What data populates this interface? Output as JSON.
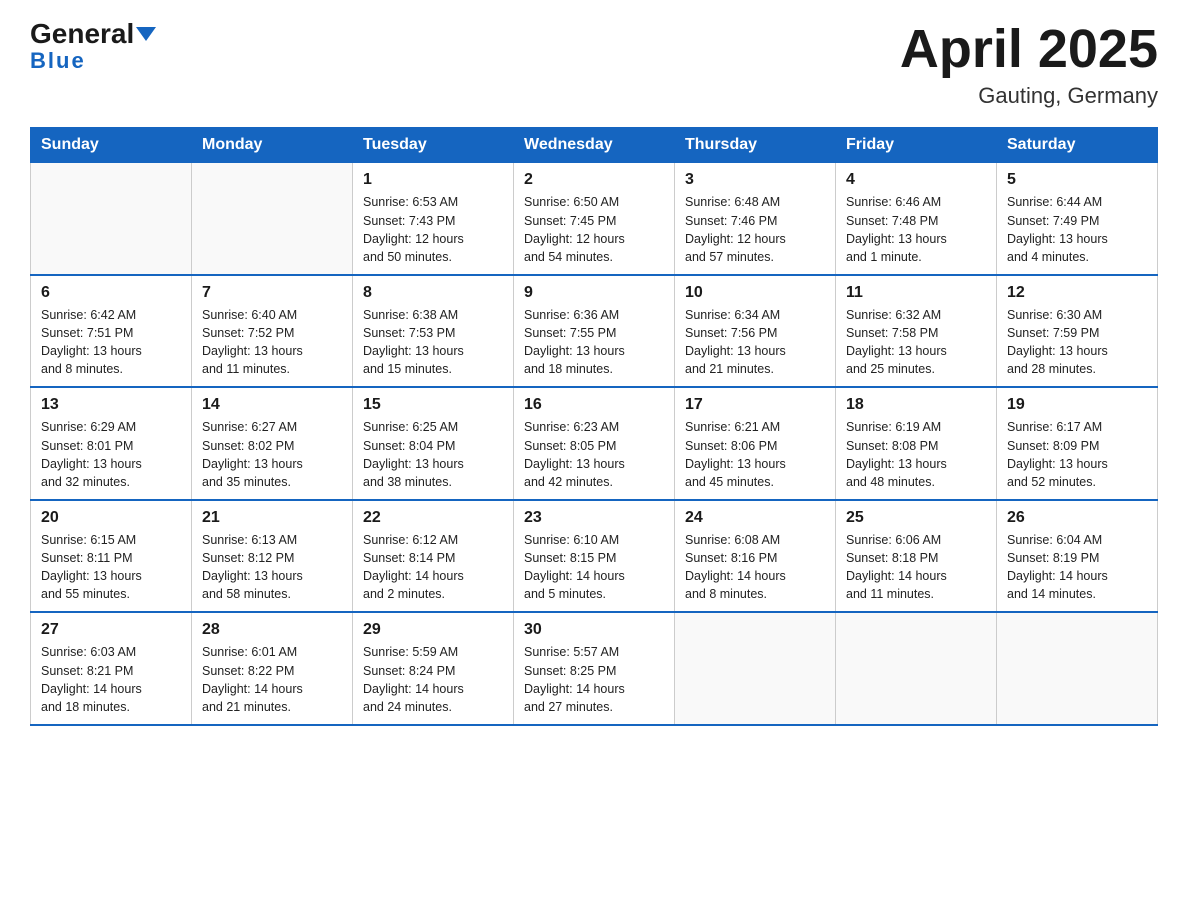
{
  "header": {
    "logo_general": "General",
    "logo_blue": "Blue",
    "title": "April 2025",
    "subtitle": "Gauting, Germany"
  },
  "weekdays": [
    "Sunday",
    "Monday",
    "Tuesday",
    "Wednesday",
    "Thursday",
    "Friday",
    "Saturday"
  ],
  "weeks": [
    [
      {
        "day": "",
        "info": ""
      },
      {
        "day": "",
        "info": ""
      },
      {
        "day": "1",
        "info": "Sunrise: 6:53 AM\nSunset: 7:43 PM\nDaylight: 12 hours\nand 50 minutes."
      },
      {
        "day": "2",
        "info": "Sunrise: 6:50 AM\nSunset: 7:45 PM\nDaylight: 12 hours\nand 54 minutes."
      },
      {
        "day": "3",
        "info": "Sunrise: 6:48 AM\nSunset: 7:46 PM\nDaylight: 12 hours\nand 57 minutes."
      },
      {
        "day": "4",
        "info": "Sunrise: 6:46 AM\nSunset: 7:48 PM\nDaylight: 13 hours\nand 1 minute."
      },
      {
        "day": "5",
        "info": "Sunrise: 6:44 AM\nSunset: 7:49 PM\nDaylight: 13 hours\nand 4 minutes."
      }
    ],
    [
      {
        "day": "6",
        "info": "Sunrise: 6:42 AM\nSunset: 7:51 PM\nDaylight: 13 hours\nand 8 minutes."
      },
      {
        "day": "7",
        "info": "Sunrise: 6:40 AM\nSunset: 7:52 PM\nDaylight: 13 hours\nand 11 minutes."
      },
      {
        "day": "8",
        "info": "Sunrise: 6:38 AM\nSunset: 7:53 PM\nDaylight: 13 hours\nand 15 minutes."
      },
      {
        "day": "9",
        "info": "Sunrise: 6:36 AM\nSunset: 7:55 PM\nDaylight: 13 hours\nand 18 minutes."
      },
      {
        "day": "10",
        "info": "Sunrise: 6:34 AM\nSunset: 7:56 PM\nDaylight: 13 hours\nand 21 minutes."
      },
      {
        "day": "11",
        "info": "Sunrise: 6:32 AM\nSunset: 7:58 PM\nDaylight: 13 hours\nand 25 minutes."
      },
      {
        "day": "12",
        "info": "Sunrise: 6:30 AM\nSunset: 7:59 PM\nDaylight: 13 hours\nand 28 minutes."
      }
    ],
    [
      {
        "day": "13",
        "info": "Sunrise: 6:29 AM\nSunset: 8:01 PM\nDaylight: 13 hours\nand 32 minutes."
      },
      {
        "day": "14",
        "info": "Sunrise: 6:27 AM\nSunset: 8:02 PM\nDaylight: 13 hours\nand 35 minutes."
      },
      {
        "day": "15",
        "info": "Sunrise: 6:25 AM\nSunset: 8:04 PM\nDaylight: 13 hours\nand 38 minutes."
      },
      {
        "day": "16",
        "info": "Sunrise: 6:23 AM\nSunset: 8:05 PM\nDaylight: 13 hours\nand 42 minutes."
      },
      {
        "day": "17",
        "info": "Sunrise: 6:21 AM\nSunset: 8:06 PM\nDaylight: 13 hours\nand 45 minutes."
      },
      {
        "day": "18",
        "info": "Sunrise: 6:19 AM\nSunset: 8:08 PM\nDaylight: 13 hours\nand 48 minutes."
      },
      {
        "day": "19",
        "info": "Sunrise: 6:17 AM\nSunset: 8:09 PM\nDaylight: 13 hours\nand 52 minutes."
      }
    ],
    [
      {
        "day": "20",
        "info": "Sunrise: 6:15 AM\nSunset: 8:11 PM\nDaylight: 13 hours\nand 55 minutes."
      },
      {
        "day": "21",
        "info": "Sunrise: 6:13 AM\nSunset: 8:12 PM\nDaylight: 13 hours\nand 58 minutes."
      },
      {
        "day": "22",
        "info": "Sunrise: 6:12 AM\nSunset: 8:14 PM\nDaylight: 14 hours\nand 2 minutes."
      },
      {
        "day": "23",
        "info": "Sunrise: 6:10 AM\nSunset: 8:15 PM\nDaylight: 14 hours\nand 5 minutes."
      },
      {
        "day": "24",
        "info": "Sunrise: 6:08 AM\nSunset: 8:16 PM\nDaylight: 14 hours\nand 8 minutes."
      },
      {
        "day": "25",
        "info": "Sunrise: 6:06 AM\nSunset: 8:18 PM\nDaylight: 14 hours\nand 11 minutes."
      },
      {
        "day": "26",
        "info": "Sunrise: 6:04 AM\nSunset: 8:19 PM\nDaylight: 14 hours\nand 14 minutes."
      }
    ],
    [
      {
        "day": "27",
        "info": "Sunrise: 6:03 AM\nSunset: 8:21 PM\nDaylight: 14 hours\nand 18 minutes."
      },
      {
        "day": "28",
        "info": "Sunrise: 6:01 AM\nSunset: 8:22 PM\nDaylight: 14 hours\nand 21 minutes."
      },
      {
        "day": "29",
        "info": "Sunrise: 5:59 AM\nSunset: 8:24 PM\nDaylight: 14 hours\nand 24 minutes."
      },
      {
        "day": "30",
        "info": "Sunrise: 5:57 AM\nSunset: 8:25 PM\nDaylight: 14 hours\nand 27 minutes."
      },
      {
        "day": "",
        "info": ""
      },
      {
        "day": "",
        "info": ""
      },
      {
        "day": "",
        "info": ""
      }
    ]
  ]
}
